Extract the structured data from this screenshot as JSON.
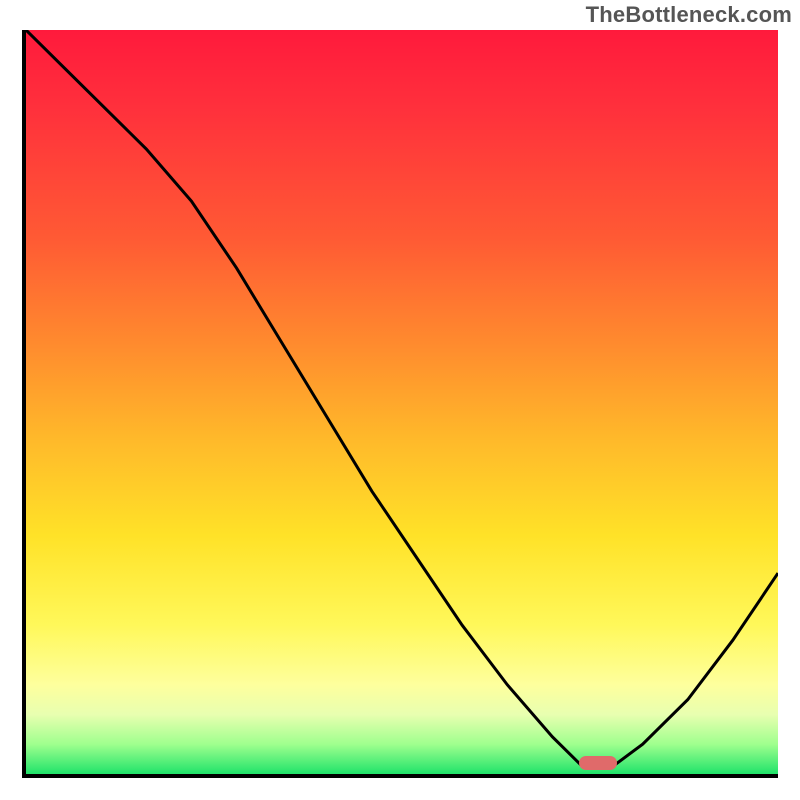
{
  "watermark": "TheBottleneck.com",
  "chart_data": {
    "type": "line",
    "title": "",
    "xlabel": "",
    "ylabel": "",
    "xlim": [
      0,
      100
    ],
    "ylim": [
      0,
      100
    ],
    "grid": false,
    "legend": false,
    "minimum_marker": {
      "x": 76,
      "y": 1.5,
      "color": "#e06a6a"
    },
    "background_gradient_stops": [
      {
        "pos": 0,
        "color": "#ff1a3c"
      },
      {
        "pos": 10,
        "color": "#ff2f3c"
      },
      {
        "pos": 28,
        "color": "#ff5a34"
      },
      {
        "pos": 42,
        "color": "#ff8a2e"
      },
      {
        "pos": 55,
        "color": "#ffb92a"
      },
      {
        "pos": 68,
        "color": "#ffe228"
      },
      {
        "pos": 80,
        "color": "#fff85a"
      },
      {
        "pos": 88,
        "color": "#feff9d"
      },
      {
        "pos": 92,
        "color": "#e8ffb0"
      },
      {
        "pos": 96,
        "color": "#9fff8e"
      },
      {
        "pos": 100,
        "color": "#20e36a"
      }
    ],
    "series": [
      {
        "name": "bottleneck-curve",
        "x": [
          0,
          8,
          16,
          22,
          28,
          34,
          40,
          46,
          52,
          58,
          64,
          70,
          74,
          78,
          82,
          88,
          94,
          100
        ],
        "y": [
          100,
          92,
          84,
          77,
          68,
          58,
          48,
          38,
          29,
          20,
          12,
          5,
          1,
          1,
          4,
          10,
          18,
          27
        ]
      }
    ],
    "colors": {
      "curve": "#000000",
      "axis": "#000000"
    }
  }
}
